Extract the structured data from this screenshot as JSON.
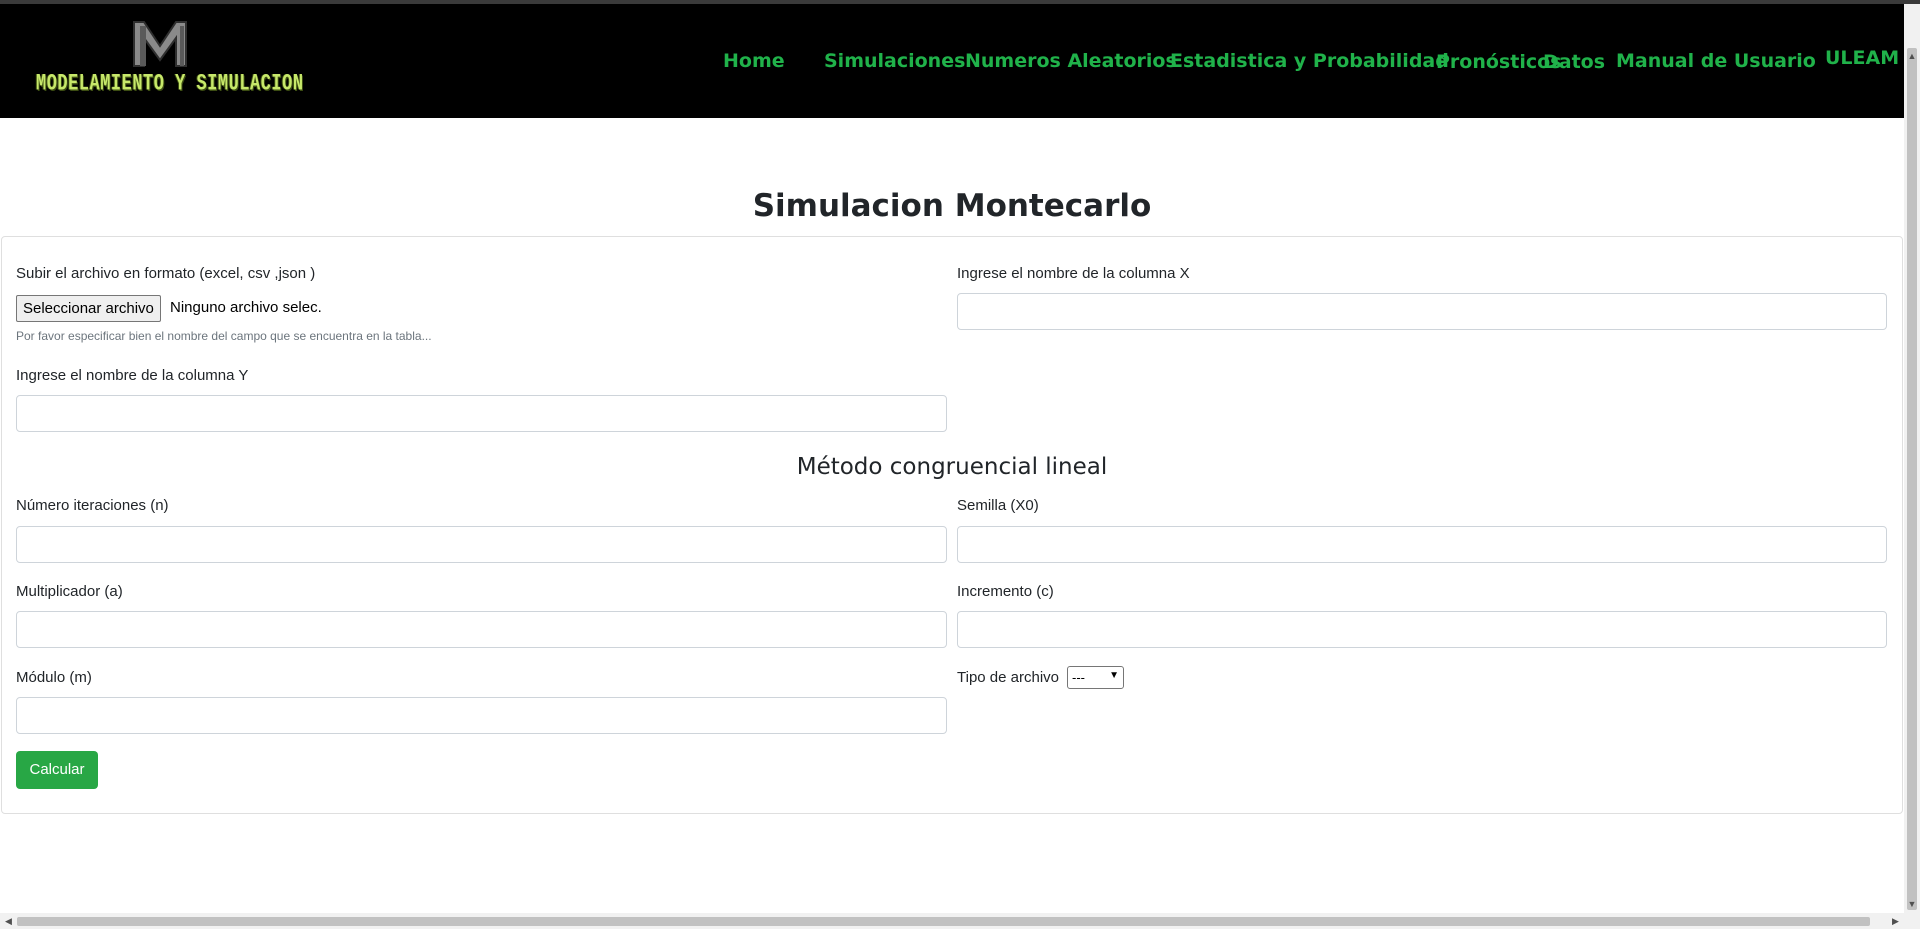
{
  "navbar": {
    "logo_text": "MODELAMIENTO Y SIMULACION",
    "items": [
      "Home",
      "Simulaciones",
      "Numeros Aleatorios",
      "Estadistica y Probabilidad",
      "Pronósticos",
      "Datos",
      "Manual de Usuario",
      "ULEAM"
    ],
    "link_color": "#20b24a",
    "background": "#000000"
  },
  "page": {
    "title": "Simulacion Montecarlo"
  },
  "form": {
    "file_label": "Subir el archivo en formato (excel, csv ,json )",
    "file_button": "Seleccionar archivo",
    "file_status": "Ninguno archivo selec.",
    "file_help": "Por favor especificar bien el nombre del campo que se encuentra en la tabla...",
    "col_x_label": "Ingrese el nombre de la columna X",
    "col_x_value": "",
    "col_y_label": "Ingrese el nombre de la columna Y",
    "col_y_value": "",
    "section_title": "Método congruencial lineal",
    "n_label": "Número iteraciones (n)",
    "n_value": "",
    "seed_label": "Semilla (X0)",
    "seed_value": "",
    "a_label": "Multiplicador (a)",
    "a_value": "",
    "c_label": "Incremento (c)",
    "c_value": "",
    "m_label": "Módulo (m)",
    "m_value": "",
    "filetype_label": "Tipo de archivo",
    "filetype_selected": "---",
    "submit_label": "Calcular",
    "submit_color": "#28a745"
  }
}
